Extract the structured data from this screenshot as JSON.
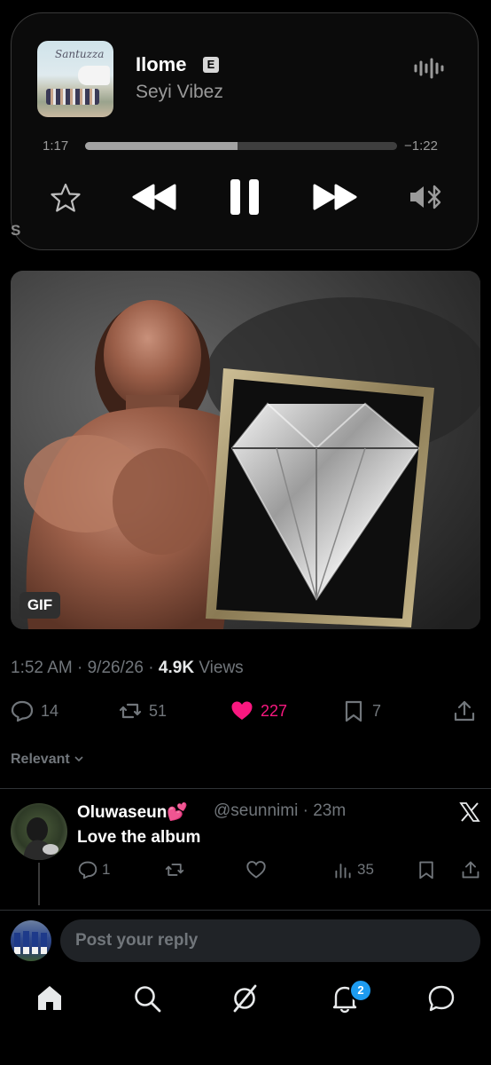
{
  "now_playing": {
    "song_title": "Ilome",
    "explicit_badge": "E",
    "artist": "Seyi Vibez",
    "album_art_script": "Santuzza",
    "elapsed": "1:17",
    "remaining": "−1:22",
    "progress_fraction": 0.49,
    "icons": [
      "waveform-icon",
      "star-icon",
      "rewind-icon",
      "pause-icon",
      "fast-forward-icon",
      "speaker-bluetooth-icon"
    ]
  },
  "partially_hidden_text": "S",
  "media": {
    "badge": "GIF"
  },
  "post_meta": {
    "time": "1:52 AM",
    "date": "9/26/26",
    "views_count": "4.9K",
    "views_label": "Views",
    "separator": "·"
  },
  "actions": {
    "replies": "14",
    "reposts": "51",
    "likes": "227",
    "bookmarks": "7"
  },
  "sort_label": "Relevant",
  "reply": {
    "name": "Oluwaseun💕",
    "handle_time": "@seunnimi · 23m",
    "text": "Love the album",
    "replies": "1",
    "views": "35"
  },
  "composer": {
    "placeholder": "Post your reply"
  },
  "bottom_nav": {
    "notifications_badge": "2"
  },
  "colors": {
    "background": "#000000",
    "like_pink": "#f91880",
    "accent_blue": "#1d9bf0",
    "muted": "#71767b"
  }
}
